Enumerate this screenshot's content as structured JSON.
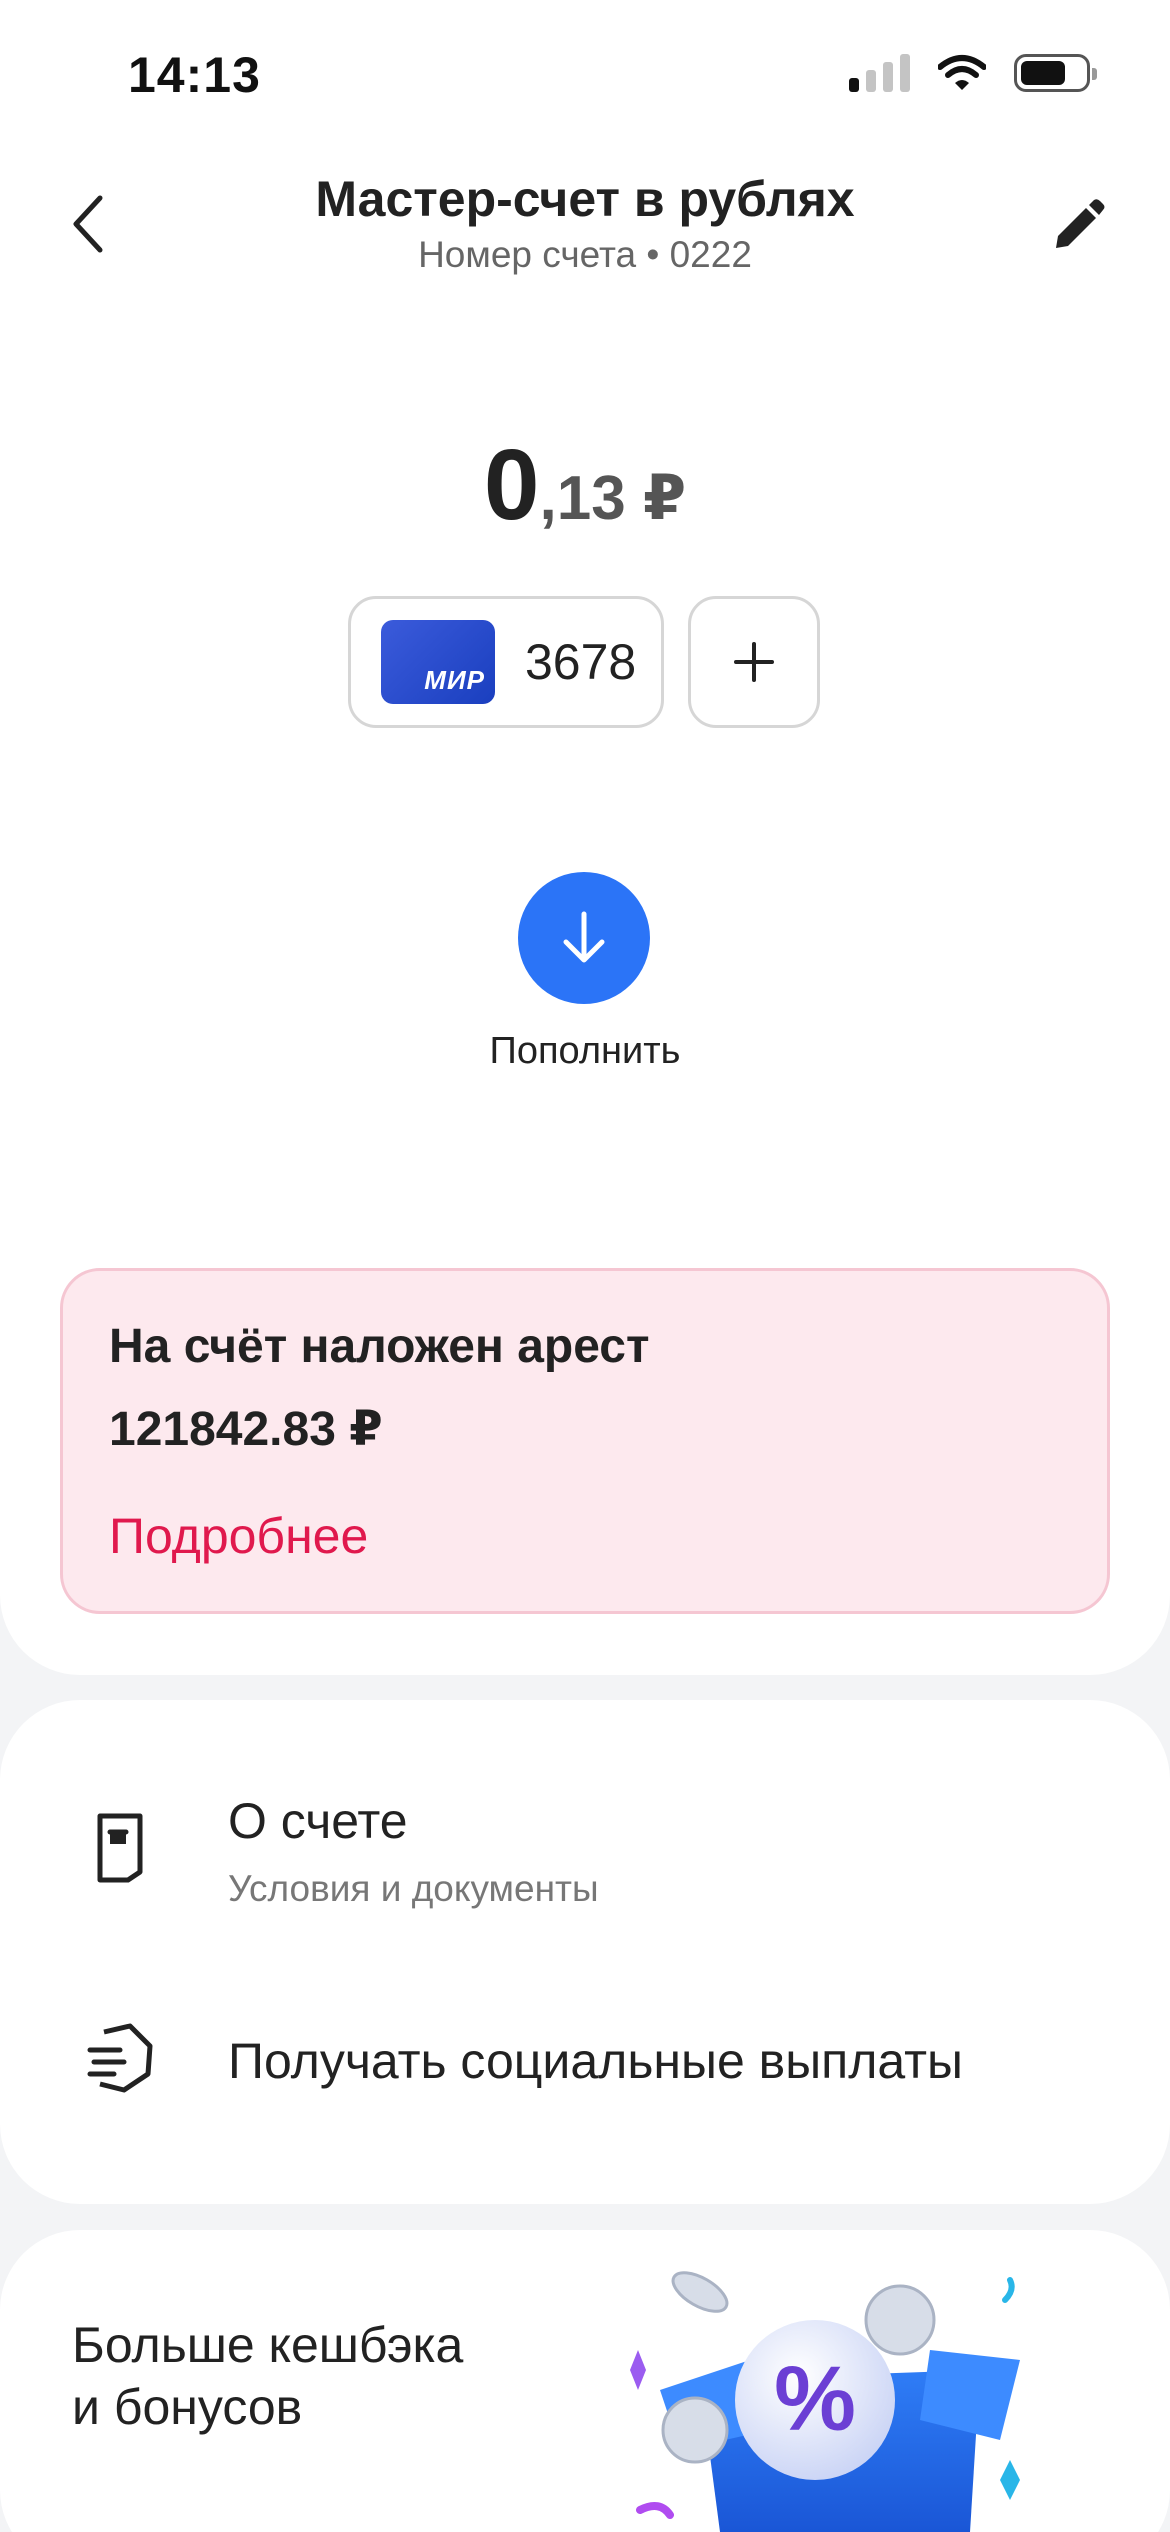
{
  "status_bar": {
    "time": "14:13"
  },
  "header": {
    "title": "Мастер-счет в рублях",
    "subtitle": "Номер счета • 0222"
  },
  "balance": {
    "integer": "0",
    "fraction": ",13 ₽"
  },
  "card": {
    "brand": "МИР",
    "last_digits": "3678"
  },
  "topup": {
    "label": "Пополнить"
  },
  "alert": {
    "title": "На счёт наложен арест",
    "amount": "121842.83 ₽",
    "link": "Подробнее"
  },
  "menu": {
    "about": {
      "title": "О счете",
      "subtitle": "Условия и документы"
    },
    "social": {
      "title": "Получать социальные выплаты"
    }
  },
  "promo": {
    "line1": "Больше кешбэка",
    "line2": "и бонусов"
  },
  "colors": {
    "accent": "#2b74f7",
    "alert_bg": "#fde9ee",
    "alert_link": "#e0194d",
    "mir": "#1a3fbf"
  },
  "icons": [
    "back-chevron-icon",
    "pencil-icon",
    "plus-icon",
    "arrow-down-icon",
    "document-icon",
    "social-payments-icon",
    "percent-gift-icon"
  ]
}
